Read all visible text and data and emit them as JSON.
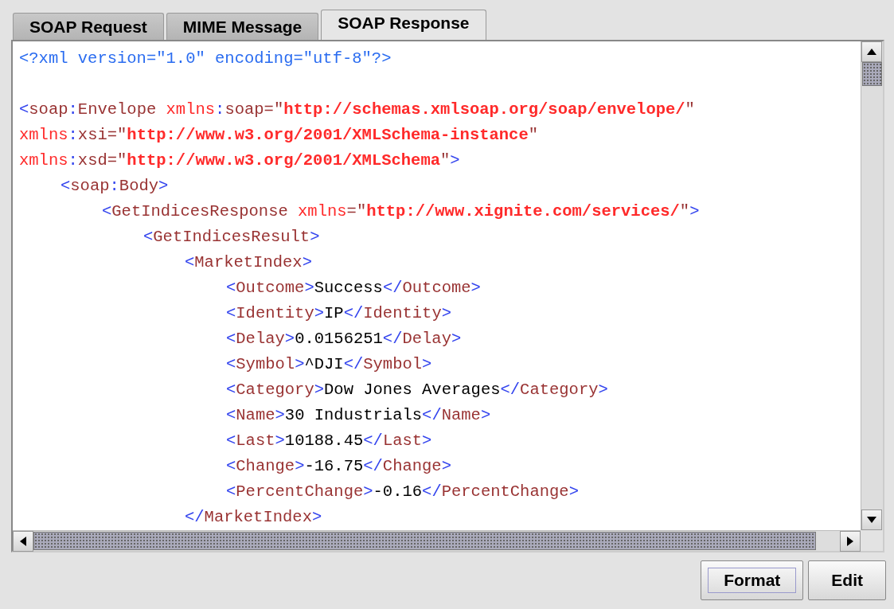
{
  "tabs": [
    {
      "label": "SOAP Request",
      "selected": false
    },
    {
      "label": "MIME Message",
      "selected": false
    },
    {
      "label": "SOAP Response",
      "selected": true
    }
  ],
  "editor": {
    "lines": [
      {
        "segments": [
          {
            "kind": "decl",
            "text": "<?xml version=\"1.0\" encoding=\"utf-8\"?>"
          }
        ]
      },
      {
        "blank_before": true,
        "segments": [
          {
            "kind": "delim",
            "text": "<"
          },
          {
            "kind": "name",
            "text": "soap"
          },
          {
            "kind": "delim",
            "text": ":"
          },
          {
            "kind": "name",
            "text": "Envelope "
          },
          {
            "kind": "attr",
            "text": "xmlns"
          },
          {
            "kind": "delim",
            "text": ":"
          },
          {
            "kind": "name",
            "text": "soap=\""
          },
          {
            "kind": "value",
            "text": "http://schemas.xmlsoap.org/soap/envelope/"
          },
          {
            "kind": "name",
            "text": "\""
          }
        ]
      },
      {
        "segments": [
          {
            "kind": "attr",
            "text": "xmlns"
          },
          {
            "kind": "delim",
            "text": ":"
          },
          {
            "kind": "name",
            "text": "xsi=\""
          },
          {
            "kind": "value",
            "text": "http://www.w3.org/2001/XMLSchema-instance"
          },
          {
            "kind": "name",
            "text": "\""
          }
        ]
      },
      {
        "segments": [
          {
            "kind": "attr",
            "text": "xmlns"
          },
          {
            "kind": "delim",
            "text": ":"
          },
          {
            "kind": "name",
            "text": "xsd=\""
          },
          {
            "kind": "value",
            "text": "http://www.w3.org/2001/XMLSchema"
          },
          {
            "kind": "name",
            "text": "\""
          },
          {
            "kind": "delim",
            "text": ">"
          }
        ],
        "children": [
          {
            "segments": [
              {
                "kind": "delim",
                "text": "<"
              },
              {
                "kind": "name",
                "text": "soap"
              },
              {
                "kind": "delim",
                "text": ":"
              },
              {
                "kind": "name",
                "text": "Body"
              },
              {
                "kind": "delim",
                "text": ">"
              }
            ],
            "children": [
              {
                "segments": [
                  {
                    "kind": "delim",
                    "text": "<"
                  },
                  {
                    "kind": "name",
                    "text": "GetIndicesResponse "
                  },
                  {
                    "kind": "attr",
                    "text": "xmlns"
                  },
                  {
                    "kind": "name",
                    "text": "=\""
                  },
                  {
                    "kind": "value",
                    "text": "http://www.xignite.com/services/"
                  },
                  {
                    "kind": "name",
                    "text": "\""
                  },
                  {
                    "kind": "delim",
                    "text": ">"
                  }
                ],
                "children": [
                  {
                    "segments": [
                      {
                        "kind": "delim",
                        "text": "<"
                      },
                      {
                        "kind": "name",
                        "text": "GetIndicesResult"
                      },
                      {
                        "kind": "delim",
                        "text": ">"
                      }
                    ],
                    "children": [
                      {
                        "segments": [
                          {
                            "kind": "delim",
                            "text": "<"
                          },
                          {
                            "kind": "name",
                            "text": "MarketIndex"
                          },
                          {
                            "kind": "delim",
                            "text": ">"
                          }
                        ],
                        "children": [
                          {
                            "segments": [
                              {
                                "kind": "delim",
                                "text": "<"
                              },
                              {
                                "kind": "name",
                                "text": "Outcome"
                              },
                              {
                                "kind": "delim",
                                "text": ">"
                              },
                              {
                                "kind": "text",
                                "text": "Success"
                              },
                              {
                                "kind": "delim",
                                "text": "</"
                              },
                              {
                                "kind": "name",
                                "text": "Outcome"
                              },
                              {
                                "kind": "delim",
                                "text": ">"
                              }
                            ]
                          },
                          {
                            "segments": [
                              {
                                "kind": "delim",
                                "text": "<"
                              },
                              {
                                "kind": "name",
                                "text": "Identity"
                              },
                              {
                                "kind": "delim",
                                "text": ">"
                              },
                              {
                                "kind": "text",
                                "text": "IP"
                              },
                              {
                                "kind": "delim",
                                "text": "</"
                              },
                              {
                                "kind": "name",
                                "text": "Identity"
                              },
                              {
                                "kind": "delim",
                                "text": ">"
                              }
                            ]
                          },
                          {
                            "segments": [
                              {
                                "kind": "delim",
                                "text": "<"
                              },
                              {
                                "kind": "name",
                                "text": "Delay"
                              },
                              {
                                "kind": "delim",
                                "text": ">"
                              },
                              {
                                "kind": "text",
                                "text": "0.0156251"
                              },
                              {
                                "kind": "delim",
                                "text": "</"
                              },
                              {
                                "kind": "name",
                                "text": "Delay"
                              },
                              {
                                "kind": "delim",
                                "text": ">"
                              }
                            ]
                          },
                          {
                            "segments": [
                              {
                                "kind": "delim",
                                "text": "<"
                              },
                              {
                                "kind": "name",
                                "text": "Symbol"
                              },
                              {
                                "kind": "delim",
                                "text": ">"
                              },
                              {
                                "kind": "text",
                                "text": "^DJI"
                              },
                              {
                                "kind": "delim",
                                "text": "</"
                              },
                              {
                                "kind": "name",
                                "text": "Symbol"
                              },
                              {
                                "kind": "delim",
                                "text": ">"
                              }
                            ]
                          },
                          {
                            "segments": [
                              {
                                "kind": "delim",
                                "text": "<"
                              },
                              {
                                "kind": "name",
                                "text": "Category"
                              },
                              {
                                "kind": "delim",
                                "text": ">"
                              },
                              {
                                "kind": "text",
                                "text": "Dow Jones Averages"
                              },
                              {
                                "kind": "delim",
                                "text": "</"
                              },
                              {
                                "kind": "name",
                                "text": "Category"
                              },
                              {
                                "kind": "delim",
                                "text": ">"
                              }
                            ]
                          },
                          {
                            "segments": [
                              {
                                "kind": "delim",
                                "text": "<"
                              },
                              {
                                "kind": "name",
                                "text": "Name"
                              },
                              {
                                "kind": "delim",
                                "text": ">"
                              },
                              {
                                "kind": "text",
                                "text": "30 Industrials"
                              },
                              {
                                "kind": "delim",
                                "text": "</"
                              },
                              {
                                "kind": "name",
                                "text": "Name"
                              },
                              {
                                "kind": "delim",
                                "text": ">"
                              }
                            ]
                          },
                          {
                            "segments": [
                              {
                                "kind": "delim",
                                "text": "<"
                              },
                              {
                                "kind": "name",
                                "text": "Last"
                              },
                              {
                                "kind": "delim",
                                "text": ">"
                              },
                              {
                                "kind": "text",
                                "text": "10188.45"
                              },
                              {
                                "kind": "delim",
                                "text": "</"
                              },
                              {
                                "kind": "name",
                                "text": "Last"
                              },
                              {
                                "kind": "delim",
                                "text": ">"
                              }
                            ]
                          },
                          {
                            "segments": [
                              {
                                "kind": "delim",
                                "text": "<"
                              },
                              {
                                "kind": "name",
                                "text": "Change"
                              },
                              {
                                "kind": "delim",
                                "text": ">"
                              },
                              {
                                "kind": "text",
                                "text": "-16.75"
                              },
                              {
                                "kind": "delim",
                                "text": "</"
                              },
                              {
                                "kind": "name",
                                "text": "Change"
                              },
                              {
                                "kind": "delim",
                                "text": ">"
                              }
                            ]
                          },
                          {
                            "segments": [
                              {
                                "kind": "delim",
                                "text": "<"
                              },
                              {
                                "kind": "name",
                                "text": "PercentChange"
                              },
                              {
                                "kind": "delim",
                                "text": ">"
                              },
                              {
                                "kind": "text",
                                "text": "-0.16"
                              },
                              {
                                "kind": "delim",
                                "text": "</"
                              },
                              {
                                "kind": "name",
                                "text": "PercentChange"
                              },
                              {
                                "kind": "delim",
                                "text": ">"
                              }
                            ]
                          }
                        ]
                      },
                      {
                        "segments": [
                          {
                            "kind": "delim",
                            "text": "</"
                          },
                          {
                            "kind": "name",
                            "text": "MarketIndex"
                          },
                          {
                            "kind": "delim",
                            "text": ">"
                          }
                        ]
                      }
                    ]
                  }
                ]
              }
            ]
          }
        ]
      }
    ]
  },
  "buttons": [
    {
      "label": "Format",
      "focused": true
    },
    {
      "label": "Edit",
      "focused": false
    }
  ]
}
